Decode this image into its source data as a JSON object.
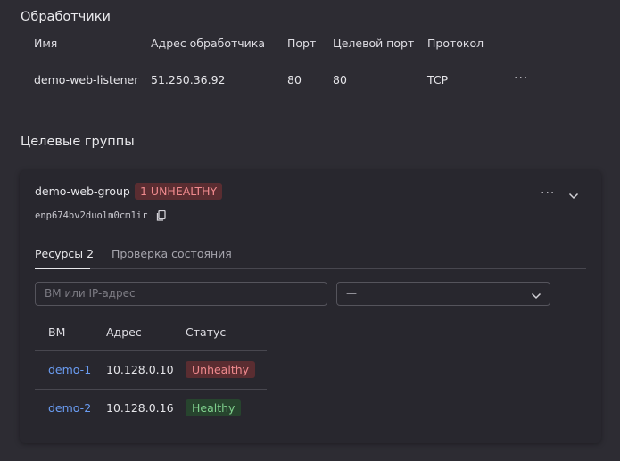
{
  "listeners": {
    "title": "Обработчики",
    "columns": [
      "Имя",
      "Адрес обработчика",
      "Порт",
      "Целевой порт",
      "Протокол"
    ],
    "rows": [
      {
        "name": "demo-web-listener",
        "address": "51.250.36.92",
        "port": "80",
        "target_port": "80",
        "protocol": "TCP",
        "menu": "···"
      }
    ]
  },
  "target_groups": {
    "title": "Целевые группы",
    "group": {
      "name": "demo-web-group",
      "badge": "1 UNHEALTHY",
      "id": "enp674bv2duolm0cm1ir",
      "menu": "···",
      "tabs": [
        {
          "label": "Ресурсы 2",
          "active": true
        },
        {
          "label": "Проверка состояния",
          "active": false
        }
      ],
      "filter": {
        "search_placeholder": "ВМ или IP-адрес",
        "select_value": "—"
      },
      "columns": [
        "ВМ",
        "Адрес",
        "Статус"
      ],
      "rows": [
        {
          "vm": "demo-1",
          "address": "10.128.0.10",
          "status": "Unhealthy"
        },
        {
          "vm": "demo-2",
          "address": "10.128.0.16",
          "status": "Healthy"
        }
      ]
    }
  },
  "colors": {
    "background": "#2d2c33",
    "card": "#28272e",
    "link": "#6a9cf2",
    "unhealthy_bg": "#5a2d31",
    "unhealthy_fg": "#f08a8e",
    "healthy_bg": "#27442e",
    "healthy_fg": "#7fd08d"
  },
  "icons": [
    "copy-icon",
    "chevron-down-icon",
    "more-icon"
  ]
}
